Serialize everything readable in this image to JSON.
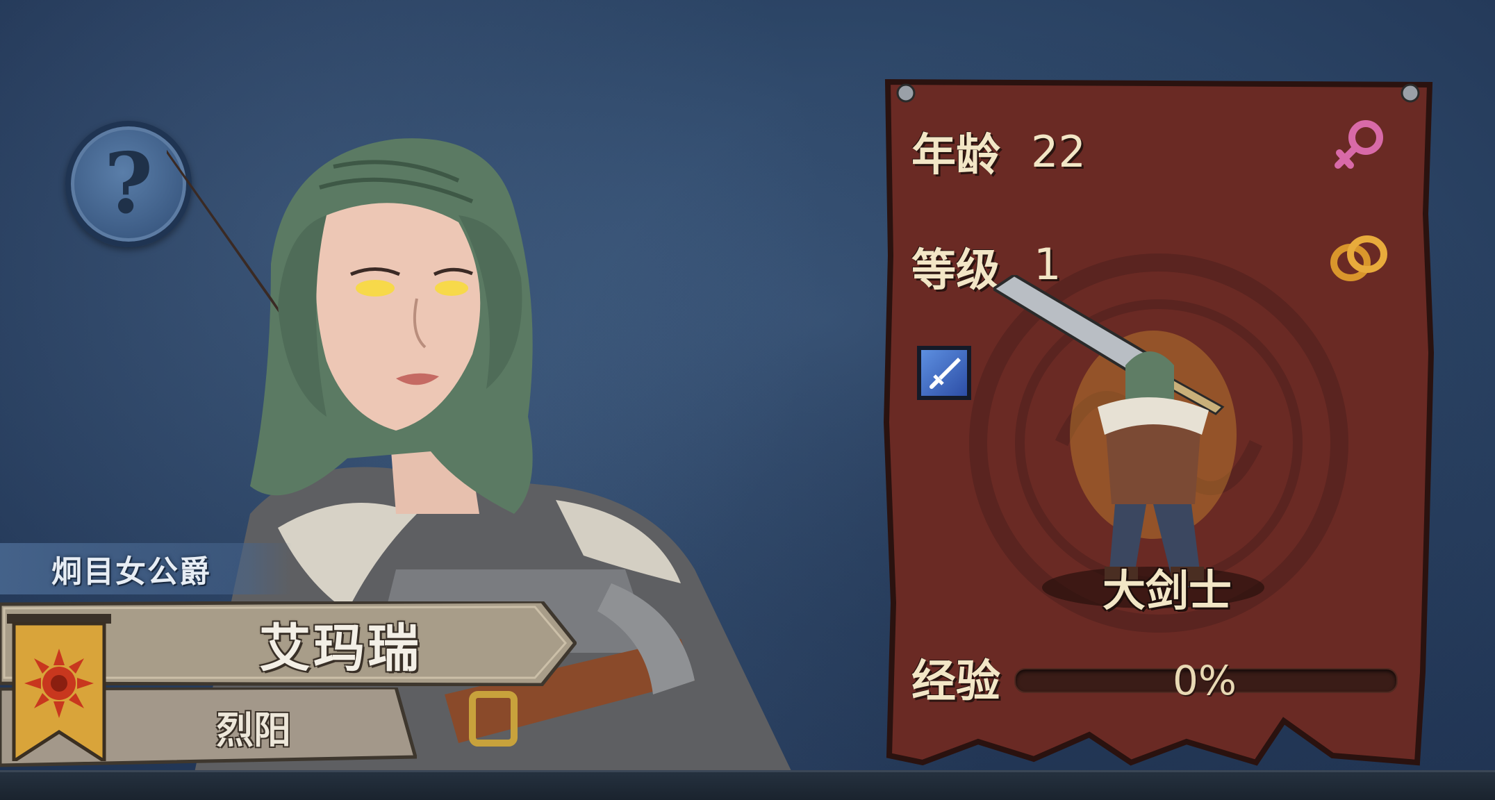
{
  "help_button": {
    "glyph": "?"
  },
  "character": {
    "title": "炯目女公爵",
    "name": "艾玛瑞",
    "faction": "烈阳"
  },
  "stats": {
    "age_label": "年龄",
    "age_value": "22",
    "level_label": "等级",
    "level_value": "1",
    "class_name": "大剑士",
    "xp_label": "经验",
    "xp_percent_text": "0%",
    "xp_progress": 0
  },
  "icons": {
    "gender": "female-symbol-icon",
    "relationship": "wedding-rings-icon",
    "skill": "sword-skill-icon",
    "faction_emblem": "sun-emblem-icon"
  },
  "colors": {
    "panel": "#6a2a24",
    "gender": "#d86aa8",
    "rings": "#d9962c",
    "banner": "#d9a43a",
    "sun": "#c8371e"
  }
}
